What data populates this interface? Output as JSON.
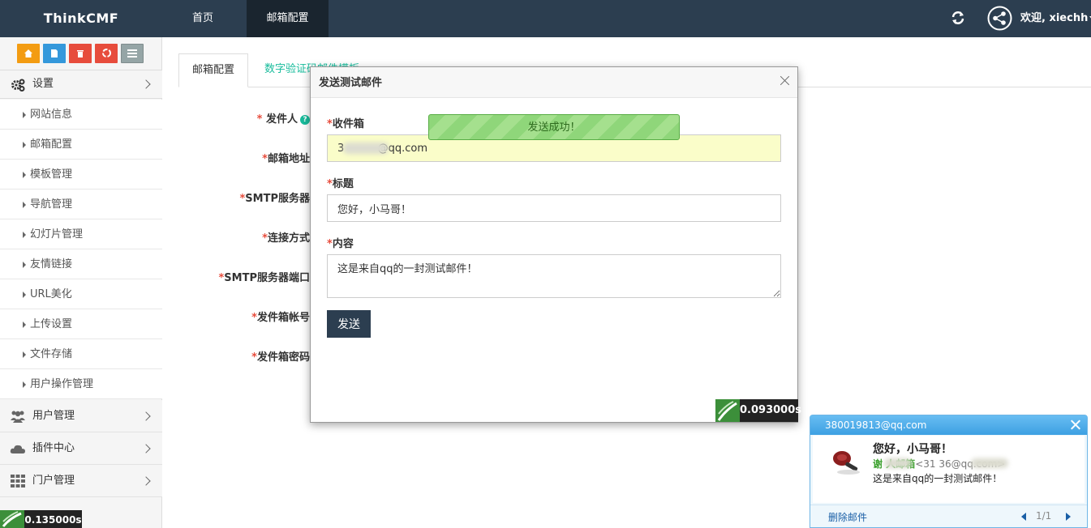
{
  "topbar": {
    "brand": "ThinkCMF",
    "nav": [
      "首页",
      "邮箱配置"
    ],
    "welcome": "欢迎, xiechh",
    "colors": {
      "bar": "#2c3e50",
      "active": "#1a252f"
    }
  },
  "sidebar": {
    "shortcut_icons": [
      "home-icon",
      "file-icon",
      "trash-icon",
      "recycle-icon",
      "list-icon"
    ],
    "settings_label": "设置",
    "sub_items": [
      "网站信息",
      "邮箱配置",
      "模板管理",
      "导航管理",
      "幻灯片管理",
      "友情链接",
      "URL美化",
      "上传设置",
      "文件存储",
      "用户操作管理"
    ],
    "bottom_menus": [
      "用户管理",
      "插件中心",
      "门户管理"
    ],
    "timer": "0.135000s"
  },
  "content": {
    "tabs": [
      "邮箱配置",
      "数字验证码邮件模板"
    ],
    "fields": [
      "发件人",
      "邮箱地址",
      "SMTP服务器",
      "连接方式",
      "SMTP服务器端口",
      "发件箱帐号",
      "发件箱密码"
    ]
  },
  "modal": {
    "title": "发送测试邮件",
    "to_label": "收件箱",
    "to_value": "3          @qq.com",
    "subject_label": "标题",
    "subject_value": "您好，小马哥！",
    "content_label": "内容",
    "content_value": "这是来自qq的一封测试邮件！",
    "send_label": "发送",
    "toast": "发送成功！",
    "timer": "0.093000s"
  },
  "notification": {
    "account": "380019813@qq.com",
    "subject": "您好，小马哥！",
    "sender_name": "谢      人邮箱",
    "sender_addr": "<31          36@qq.com>",
    "snippet": "这是来自qq的一封测试邮件！",
    "delete_label": "删除邮件",
    "page": "1/1"
  }
}
